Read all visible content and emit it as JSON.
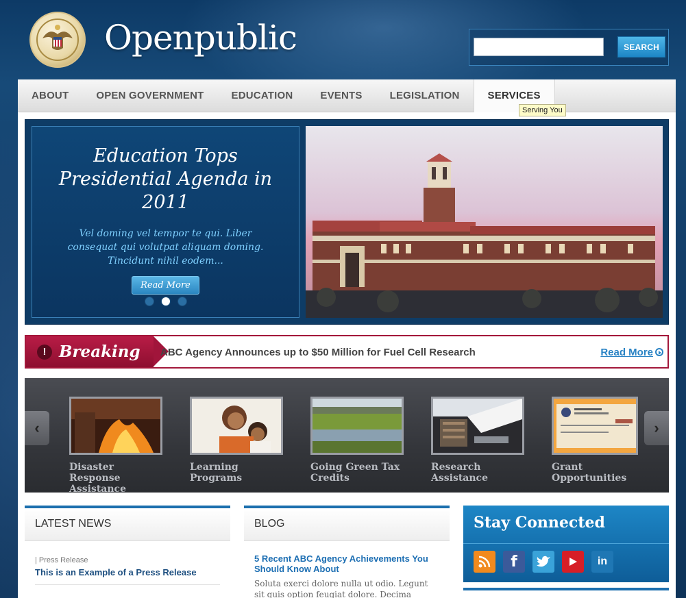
{
  "header": {
    "site_title": "Openpublic",
    "search": {
      "placeholder": "",
      "button_label": "SEARCH"
    }
  },
  "nav": {
    "items": [
      {
        "label": "ABOUT"
      },
      {
        "label": "OPEN GOVERNMENT"
      },
      {
        "label": "EDUCATION"
      },
      {
        "label": "EVENTS"
      },
      {
        "label": "LEGISLATION"
      },
      {
        "label": "SERVICES",
        "active": true
      }
    ],
    "tooltip": "Serving You"
  },
  "feature": {
    "title": "Education Tops Presidential Agenda in 2011",
    "description": "Vel doming vel tempor te qui. Liber consequat qui volutpat aliquam doming. Tincidunt nihil eodem...",
    "button_label": "Read More",
    "slide_count": 3,
    "active_slide": 2
  },
  "breaking": {
    "label": "Breaking",
    "headline": "ABC Agency Announces up to $50 Million for Fuel Cell Research",
    "link_label": "Read More"
  },
  "carousel": {
    "items": [
      {
        "label": "Disaster Response Assistance",
        "icon": "fire-photo"
      },
      {
        "label": "Learning Programs",
        "icon": "family-photo"
      },
      {
        "label": "Going Green Tax Credits",
        "icon": "wetland-photo"
      },
      {
        "label": "Research Assistance",
        "icon": "library-photo"
      },
      {
        "label": "Grant Opportunities",
        "icon": "check-photo"
      }
    ]
  },
  "latest_news": {
    "heading": "LATEST NEWS",
    "items": [
      {
        "meta": "| Press Release",
        "title": "This is an Example of a Press Release"
      }
    ]
  },
  "blog": {
    "heading": "BLOG",
    "post_title": "5 Recent ABC Agency Achievements You Should Know About",
    "post_excerpt": "Soluta exerci dolore nulla ut odio. Legunt sit quis option feugiat dolore. Decima minim duis wisi..."
  },
  "stay_connected": {
    "heading": "Stay Connected",
    "icons": [
      "rss-icon",
      "facebook-icon",
      "twitter-icon",
      "youtube-icon",
      "linkedin-icon"
    ]
  },
  "colors": {
    "brand_blue": "#1c6fae",
    "breaking_red": "#a3173a",
    "nav_bg": "#e6e6e6"
  }
}
